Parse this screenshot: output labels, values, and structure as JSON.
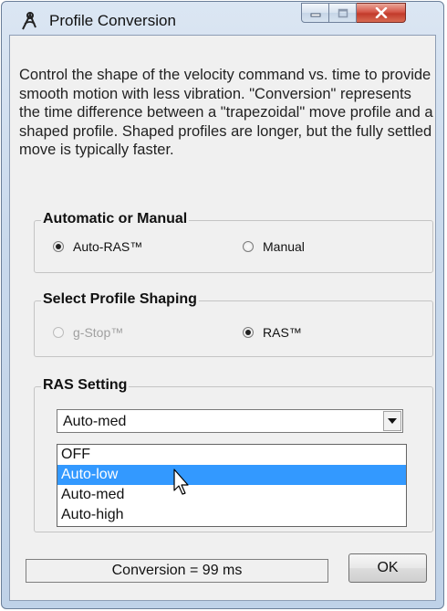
{
  "window": {
    "title": "Profile Conversion",
    "icon": "compass-icon",
    "controls": {
      "minimize": "minimize-icon",
      "maximize": "maximize-icon",
      "close": "close-icon"
    }
  },
  "description": "Control the shape of the velocity command vs. time to provide smooth motion with less vibration. \"Conversion\" represents the time difference between a \"trapezoidal\" move profile and a shaped profile. Shaped profiles are longer, but the fully settled move is typically faster.",
  "mode_group": {
    "label": "Automatic or Manual",
    "options": [
      {
        "label": "Auto-RAS™",
        "checked": true,
        "enabled": true
      },
      {
        "label": "Manual",
        "checked": false,
        "enabled": true
      }
    ]
  },
  "shaping_group": {
    "label": "Select Profile Shaping",
    "options": [
      {
        "label": "g-Stop™",
        "checked": false,
        "enabled": false
      },
      {
        "label": "RAS™",
        "checked": true,
        "enabled": true
      }
    ]
  },
  "ras_group": {
    "label": "RAS Setting",
    "selected": "Auto-med",
    "options": [
      "OFF",
      "Auto-low",
      "Auto-med",
      "Auto-high"
    ],
    "highlighted": "Auto-low"
  },
  "status": {
    "text": "Conversion = 99 ms"
  },
  "ok_button": {
    "label": "OK"
  },
  "colors": {
    "highlight": "#3399ff",
    "close_button": "#c23a2b"
  }
}
